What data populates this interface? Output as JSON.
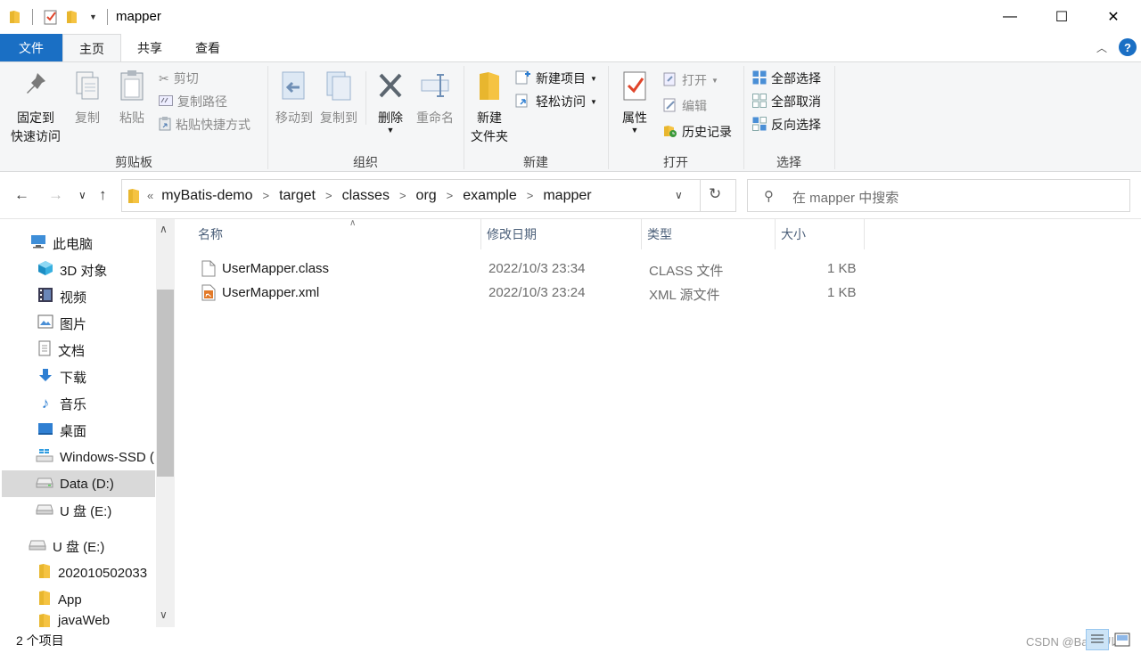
{
  "window": {
    "title": "mapper",
    "controls": {
      "minimize": "—",
      "maximize": "☐",
      "close": "✕"
    }
  },
  "ribbon_tabs": [
    {
      "label": "文件",
      "state": "file"
    },
    {
      "label": "主页",
      "state": "active"
    },
    {
      "label": "共享",
      "state": "normal"
    },
    {
      "label": "查看",
      "state": "normal"
    }
  ],
  "ribbon": {
    "clipboard": {
      "label": "剪贴板",
      "pin_line1": "固定到",
      "pin_line2": "快速访问",
      "copy": "复制",
      "paste": "粘贴",
      "cut": "剪切",
      "copy_path": "复制路径",
      "paste_shortcut": "粘贴快捷方式"
    },
    "organize": {
      "label": "组织",
      "move_to": "移动到",
      "copy_to": "复制到",
      "delete": "删除",
      "rename": "重命名"
    },
    "new": {
      "label": "新建",
      "new_folder_line1": "新建",
      "new_folder_line2": "文件夹",
      "new_item": "新建项目",
      "easy_access": "轻松访问"
    },
    "open": {
      "label": "打开",
      "properties": "属性",
      "open": "打开",
      "edit": "编辑",
      "history": "历史记录"
    },
    "select": {
      "label": "选择",
      "select_all": "全部选择",
      "select_none": "全部取消",
      "invert": "反向选择"
    }
  },
  "address": {
    "lead": "«",
    "crumbs": [
      "myBatis-demo",
      "target",
      "classes",
      "org",
      "example",
      "mapper"
    ],
    "search_placeholder": "在 mapper 中搜索"
  },
  "nav_pane": {
    "items": [
      {
        "label": "此电脑",
        "icon": "computer-icon"
      },
      {
        "label": "3D 对象",
        "icon": "3d-objects-icon"
      },
      {
        "label": "视频",
        "icon": "video-icon"
      },
      {
        "label": "图片",
        "icon": "pictures-icon"
      },
      {
        "label": "文档",
        "icon": "documents-icon"
      },
      {
        "label": "下载",
        "icon": "download-icon"
      },
      {
        "label": "音乐",
        "icon": "music-icon"
      },
      {
        "label": "桌面",
        "icon": "desktop-icon"
      },
      {
        "label": "Windows-SSD (",
        "icon": "windows-drive-icon"
      },
      {
        "label": "Data (D:)",
        "icon": "drive-icon",
        "selected": true
      },
      {
        "label": "U 盘 (E:)",
        "icon": "usb-drive-icon"
      },
      {
        "label": "U 盘 (E:)",
        "icon": "usb-drive-icon"
      },
      {
        "label": "202010502033",
        "icon": "folder-icon"
      },
      {
        "label": "App",
        "icon": "folder-icon"
      },
      {
        "label": "javaWeb",
        "icon": "folder-icon"
      }
    ]
  },
  "file_list": {
    "columns": [
      "名称",
      "修改日期",
      "类型",
      "大小"
    ],
    "files": [
      {
        "name": "UserMapper.class",
        "date": "2022/10/3 23:34",
        "type": "CLASS 文件",
        "size": "1 KB",
        "icon": "file-icon"
      },
      {
        "name": "UserMapper.xml",
        "date": "2022/10/3 23:24",
        "type": "XML 源文件",
        "size": "1 KB",
        "icon": "xml-file-icon"
      }
    ]
  },
  "status": {
    "item_count": "2 个项目",
    "watermark": "CSDN @Ba野_ル"
  },
  "colors": {
    "accent": "#1a6fc4",
    "ribbon_bg": "#f5f6f7",
    "selection": "#d9d9d9",
    "folder": "#f5c342"
  }
}
